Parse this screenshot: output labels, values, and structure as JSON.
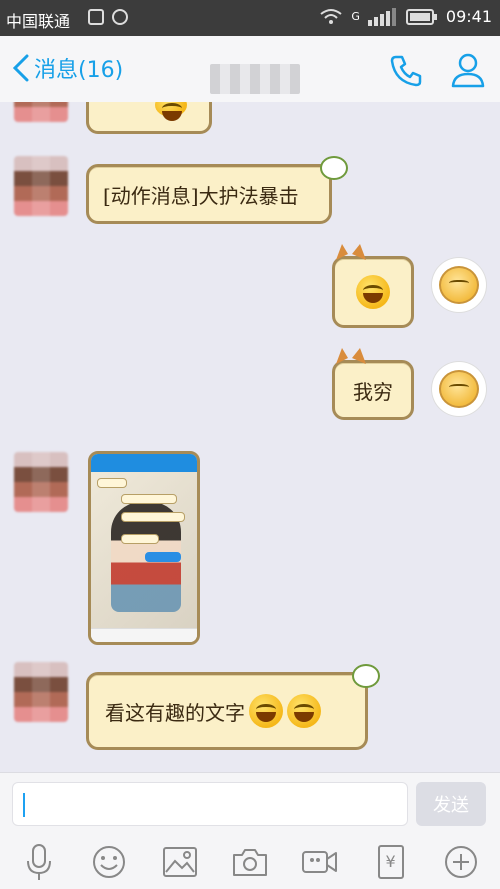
{
  "status_bar": {
    "carrier": "中国联通",
    "network": "G",
    "time": "09:41"
  },
  "header": {
    "back_label": "消息(16)",
    "icons": [
      "phone-icon",
      "profile-icon"
    ]
  },
  "messages": [
    {
      "from": "other",
      "type": "text",
      "text": "[动作消息]大护法暴击"
    },
    {
      "from": "self",
      "type": "emoji",
      "emoji": "laugh-cry-emoji"
    },
    {
      "from": "self",
      "type": "text",
      "text": "我穷"
    },
    {
      "from": "other",
      "type": "image",
      "image": "chat-screenshot"
    },
    {
      "from": "other",
      "type": "text",
      "text": "看这有趣的文字",
      "trailing_emojis": [
        "laugh-cry-emoji",
        "laugh-cry-emoji"
      ]
    }
  ],
  "input_bar": {
    "placeholder": "",
    "send_label": "发送"
  },
  "toolbar": {
    "icons": [
      "microphone-icon",
      "emoji-icon",
      "image-icon",
      "camera-icon",
      "video-icon",
      "red-packet-icon",
      "plus-icon"
    ],
    "red_packet_glyph": "¥"
  },
  "colors": {
    "accent": "#17a0e8",
    "bubble_fill": "#fbf0c8",
    "bubble_border": "#a68b57",
    "chat_bg": "#e9e9f2"
  }
}
